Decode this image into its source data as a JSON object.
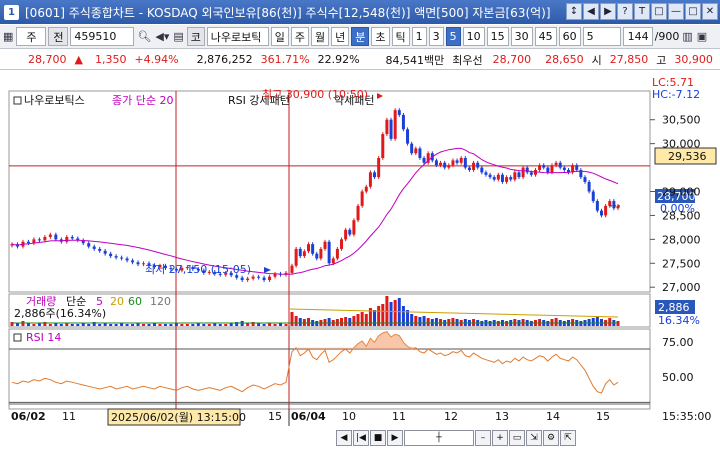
{
  "window": {
    "num": "1",
    "title": "[0601] 주식종합차트 - KOSDAQ 외국인보유[86(천)] 주식수[12,548(천)] 액면[500] 자본금[63(억)]",
    "buttons": [
      "↕",
      "◀",
      "▶",
      "?",
      "T",
      "□",
      "—",
      "□",
      "✕"
    ]
  },
  "toolbar": {
    "type_select": "주",
    "all_label": "전",
    "code": "459510",
    "market_label": "코",
    "stock_name": "나우로보틱",
    "periods": [
      "일",
      "주",
      "월",
      "년",
      "분",
      "초",
      "틱"
    ],
    "selected_period": "분",
    "intervals": [
      "1",
      "3",
      "5",
      "10",
      "15",
      "30",
      "45",
      "60"
    ],
    "selected_interval": "5",
    "interval_value": "5",
    "count": "144",
    "count_total": "/900"
  },
  "pricebar": {
    "price": "28,700",
    "change": "1,350",
    "change_pct": "+4.94%",
    "volume": "2,876,252",
    "vol_ratio": "361.71%",
    "turnover": "22.92%",
    "amount": "84,541백만",
    "best_label": "최우선",
    "best_ask": "28,700",
    "best_bid": "28,650",
    "open_label": "시",
    "open": "27,850",
    "high_label": "고",
    "high": "30,900"
  },
  "chart_data": {
    "type": "candlestick",
    "legend_price": [
      "나우로보틱스",
      "종가 단순 20",
      "RSI 강세패턴",
      "약세패턴"
    ],
    "lc_label": "LC:5.71",
    "hc_label": "HC:-7.12",
    "high_note": "최고 30,900 (10:50)",
    "low_note": "최저 27,150 (15:05)",
    "cross_price": "29,536",
    "current_price": "28,700",
    "current_pct": "0.00%",
    "y_ticks": [
      "30,500",
      "30,000",
      "29,000",
      "28,500",
      "28,000",
      "27,500",
      "27,000"
    ],
    "ylim": [
      26900,
      31100
    ],
    "volume_panel": {
      "legend": [
        "거래량",
        "단순",
        "5",
        "20",
        "60",
        "120"
      ],
      "value": "2,886주(16.34%)",
      "right_value": "2,886",
      "right_pct": "16.34%"
    },
    "rsi_panel": {
      "legend": "RSI 14",
      "ticks": [
        "75.00",
        "50.00"
      ]
    },
    "x_labels": [
      "06/02",
      "11",
      "15",
      "06/04",
      "10",
      "11",
      "12",
      "13",
      "14",
      "15"
    ],
    "cursor_time": "2025/06/02(월) 13:15:00",
    "clock": "15:35:00",
    "day1_closes": [
      27900,
      27850,
      27950,
      27920,
      28000,
      27980,
      28050,
      28100,
      28000,
      27950,
      28050,
      28020,
      27980,
      27920,
      27850,
      27800,
      27760,
      27700,
      27650,
      27620,
      27600,
      27560,
      27520,
      27480,
      27500,
      27460,
      27420,
      27450,
      27400,
      27380,
      27350,
      27400,
      27420,
      27380,
      27350,
      27300,
      27320,
      27280,
      27260,
      27300,
      27250,
      27200,
      27150,
      27180,
      27220,
      27200,
      27150,
      27220,
      27280,
      27260,
      27300
    ],
    "day2_closes": [
      27450,
      27800,
      27650,
      27750,
      27900,
      27700,
      27600,
      27800,
      27950,
      27500,
      27600,
      27800,
      28000,
      28200,
      28100,
      28400,
      28700,
      29000,
      29100,
      29400,
      29300,
      29700,
      30200,
      30500,
      30100,
      30700,
      30600,
      30300,
      30000,
      29800,
      29900,
      29700,
      29600,
      29800,
      29650,
      29550,
      29600,
      29500,
      29550,
      29650,
      29600,
      29700,
      29500,
      29450,
      29600,
      29500,
      29400,
      29350,
      29300,
      29250,
      29350,
      29200,
      29300,
      29250,
      29400,
      29300,
      29500,
      29400,
      29350,
      29450,
      29550,
      29500,
      29400,
      29550,
      29600,
      29500,
      29450,
      29400,
      29550,
      29450,
      29300,
      29200,
      29000,
      28800,
      28600,
      28500,
      28700,
      28800,
      28650,
      28700
    ],
    "volumes_day1": [
      4,
      3,
      5,
      3,
      2,
      3,
      4,
      2,
      3,
      2,
      3,
      2,
      2,
      3,
      2,
      4,
      2,
      3,
      2,
      2,
      3,
      2,
      2,
      3,
      2,
      2,
      3,
      2,
      2,
      2,
      3,
      2,
      2,
      2,
      3,
      2,
      2,
      3,
      2,
      2,
      3,
      4,
      5,
      3,
      4,
      3,
      2,
      3,
      2,
      3,
      2
    ],
    "volumes_day2": [
      14,
      10,
      8,
      7,
      8,
      6,
      5,
      6,
      7,
      8,
      6,
      7,
      8,
      9,
      8,
      10,
      12,
      14,
      12,
      18,
      16,
      20,
      22,
      30,
      24,
      26,
      28,
      20,
      16,
      12,
      10,
      9,
      10,
      8,
      7,
      8,
      7,
      6,
      7,
      8,
      7,
      6,
      7,
      6,
      7,
      6,
      5,
      6,
      5,
      6,
      5,
      6,
      5,
      6,
      7,
      6,
      7,
      6,
      5,
      6,
      7,
      6,
      5,
      7,
      8,
      6,
      5,
      6,
      7,
      6,
      5,
      6,
      7,
      8,
      9,
      7,
      6,
      8,
      6,
      5
    ],
    "rsi_day1": [
      45,
      44,
      46,
      45,
      47,
      46,
      48,
      47,
      45,
      44,
      46,
      45,
      44,
      43,
      42,
      41,
      40,
      41,
      42,
      40,
      41,
      42,
      40,
      41,
      42,
      41,
      40,
      42,
      41,
      40,
      39,
      41,
      42,
      40,
      39,
      40,
      41,
      40,
      39,
      41,
      42,
      40,
      38,
      41,
      43,
      42,
      40,
      42,
      44,
      43,
      45
    ],
    "rsi_day2": [
      68,
      71,
      65,
      67,
      70,
      64,
      62,
      66,
      69,
      60,
      62,
      65,
      68,
      70,
      67,
      71,
      74,
      76,
      72,
      78,
      75,
      80,
      82,
      83,
      79,
      81,
      80,
      75,
      72,
      70,
      71,
      68,
      67,
      70,
      68,
      66,
      67,
      65,
      66,
      68,
      67,
      69,
      65,
      64,
      67,
      65,
      63,
      62,
      61,
      60,
      62,
      59,
      61,
      60,
      63,
      61,
      64,
      62,
      61,
      63,
      65,
      64,
      61,
      64,
      66,
      63,
      62,
      61,
      64,
      62,
      58,
      54,
      48,
      42,
      38,
      37,
      44,
      47,
      43,
      45
    ]
  }
}
